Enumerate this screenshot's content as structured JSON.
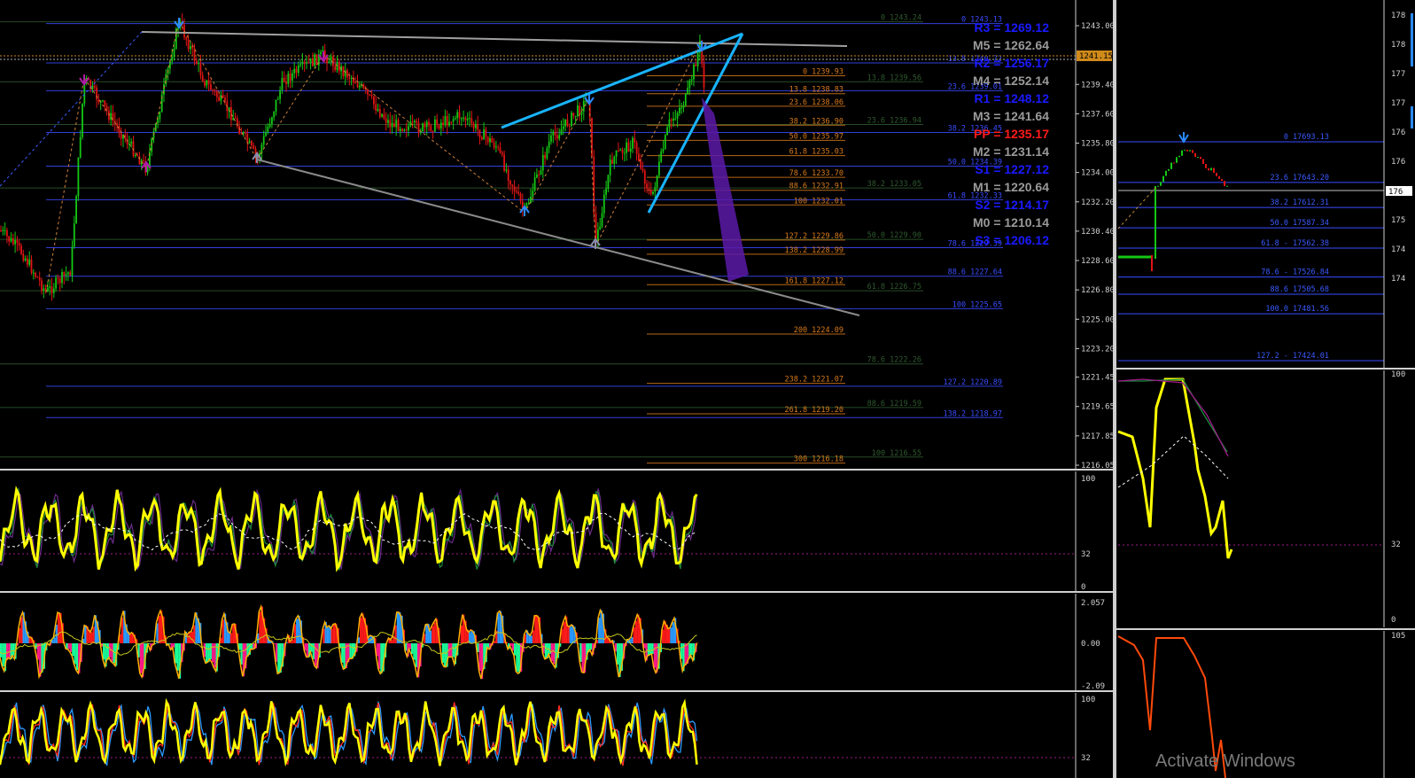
{
  "main_chart": {
    "price_axis": [
      "1243.00",
      "1241.15",
      "1239.40",
      "1237.60",
      "1235.80",
      "1234.00",
      "1232.20",
      "1230.40",
      "1228.60",
      "1226.80",
      "1225.00",
      "1223.20",
      "1221.45",
      "1219.65",
      "1217.85",
      "1216.05"
    ],
    "current_price": "1241.15",
    "pivots": [
      {
        "label": "R3 = 1269.12",
        "color": "#1a1aff"
      },
      {
        "label": "M5 = 1262.64",
        "color": "#9a9a9a"
      },
      {
        "label": "R2 = 1256.17",
        "color": "#1a1aff"
      },
      {
        "label": "M4 = 1252.14",
        "color": "#9a9a9a"
      },
      {
        "label": "R1 = 1248.12",
        "color": "#1a1aff"
      },
      {
        "label": "M3 = 1241.64",
        "color": "#9a9a9a"
      },
      {
        "label": "PP = 1235.17",
        "color": "#ff1a1a"
      },
      {
        "label": "M2 = 1231.14",
        "color": "#9a9a9a"
      },
      {
        "label": "S1 = 1227.12",
        "color": "#1a1aff"
      },
      {
        "label": "M1 = 1220.64",
        "color": "#9a9a9a"
      },
      {
        "label": "S2 = 1214.17",
        "color": "#1a1aff"
      },
      {
        "label": "M0 = 1210.14",
        "color": "#9a9a9a"
      },
      {
        "label": "S3 = 1206.12",
        "color": "#1a1aff"
      }
    ],
    "fib_orange": [
      "0 1239.93",
      "13.8 1238.83",
      "23.6 1238.06",
      "38.2 1236.90",
      "50.0 1235.97",
      "61.8 1235.03",
      "78.6 1233.70",
      "88.6 1232.91",
      "100 1232.01",
      "127.2 1229.86",
      "138.2 1228.99",
      "161.8 1227.12",
      "200 1224.09",
      "238.2 1221.07",
      "261.8 1219.20",
      "300 1216.18"
    ],
    "fib_green": [
      "0 1243.24",
      "13.8 1239.56",
      "23.6 1236.94",
      "38.2 1233.05",
      "50.0 1229.90",
      "61.8 1226.75",
      "78.6 1222.26",
      "88.6 1219.59",
      "100 1216.55"
    ],
    "fib_blue": [
      "0 1243.13",
      "13.8 1240.72",
      "23.6 1239.01",
      "38.2 1236.45",
      "50.0 1234.39",
      "61.8 1232.33",
      "78.6 1229.39",
      "88.6 1227.64",
      "100 1225.65",
      "127.2 1220.89",
      "138.2 1218.97"
    ]
  },
  "osc1": {
    "levels": [
      "100",
      "32",
      "0"
    ]
  },
  "osc2": {
    "levels": [
      "2.057",
      "0.00",
      "-2.09"
    ]
  },
  "osc3": {
    "levels": [
      "100",
      "32"
    ]
  },
  "right_chart": {
    "axis": [
      "178",
      "178",
      "177",
      "177",
      "176",
      "176",
      "175",
      "175",
      "174",
      "174"
    ],
    "current_price": "176",
    "fibs": [
      "0 17693.13",
      "23.6 17643.20",
      "38.2 17612.31",
      "50.0 17587.34",
      "61.8 - 17562.38",
      "78.6 - 17526.84",
      "88.6 17505.68",
      "100.0 17481.56",
      "127.2 - 17424.01"
    ]
  },
  "right_osc1": {
    "levels": [
      "100",
      "32",
      "0"
    ]
  },
  "right_osc2": {
    "levels": [
      "105"
    ]
  },
  "watermark": "Activate Windows",
  "colors": {
    "background": "#000000",
    "bull": "#14c814",
    "bear": "#e01414",
    "indicator_yellow": "#ffff00",
    "trend_cyan": "#19b4ff",
    "grid_blue": "#2a3cff"
  }
}
